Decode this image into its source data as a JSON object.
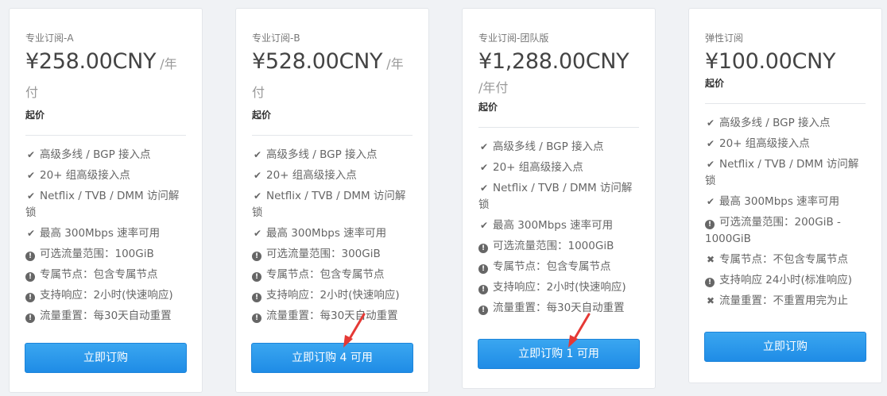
{
  "plans": [
    {
      "name": "专业订阅-A",
      "price": "¥258.00CNY",
      "unit_inline": "/年",
      "unit_wrap": "付",
      "qi": "起价",
      "features": [
        {
          "icon": "check-icon",
          "text": "高级多线 / BGP 接入点"
        },
        {
          "icon": "check-icon",
          "text": "20+ 组高级接入点"
        },
        {
          "icon": "check-icon",
          "text": "Netflix / TVB / DMM 访问解锁"
        },
        {
          "icon": "check-icon",
          "text": "最高 300Mbps 速率可用"
        },
        {
          "icon": "info-icon",
          "text": "可选流量范围：100GiB"
        },
        {
          "icon": "info-icon",
          "text": "专属节点：包含专属节点"
        },
        {
          "icon": "info-icon",
          "text": "支持响应：2小时(快速响应)"
        },
        {
          "icon": "info-icon",
          "text": "流量重置：每30天自动重置"
        }
      ],
      "button": "立即订购"
    },
    {
      "name": "专业订阅-B",
      "price": "¥528.00CNY",
      "unit_inline": "/年",
      "unit_wrap": "付",
      "qi": "起价",
      "features": [
        {
          "icon": "check-icon",
          "text": "高级多线 / BGP 接入点"
        },
        {
          "icon": "check-icon",
          "text": "20+ 组高级接入点"
        },
        {
          "icon": "check-icon",
          "text": "Netflix / TVB / DMM 访问解锁"
        },
        {
          "icon": "check-icon",
          "text": "最高 300Mbps 速率可用"
        },
        {
          "icon": "info-icon",
          "text": "可选流量范围：300GiB"
        },
        {
          "icon": "info-icon",
          "text": "专属节点：包含专属节点"
        },
        {
          "icon": "info-icon",
          "text": "支持响应：2小时(快速响应)"
        },
        {
          "icon": "info-icon",
          "text": "流量重置：每30天自动重置"
        }
      ],
      "button": "立即订购 4 可用"
    },
    {
      "name": "专业订阅-团队版",
      "price": "¥1,288.00CNY",
      "unit_inline": "",
      "unit_wrap": "/年付",
      "qi": "起价",
      "features": [
        {
          "icon": "check-icon",
          "text": "高级多线 / BGP 接入点"
        },
        {
          "icon": "check-icon",
          "text": "20+ 组高级接入点"
        },
        {
          "icon": "check-icon",
          "text": "Netflix / TVB / DMM 访问解锁"
        },
        {
          "icon": "check-icon",
          "text": "最高 300Mbps 速率可用"
        },
        {
          "icon": "info-icon",
          "text": "可选流量范围：1000GiB"
        },
        {
          "icon": "info-icon",
          "text": "专属节点：包含专属节点"
        },
        {
          "icon": "info-icon",
          "text": "支持响应：2小时(快速响应)"
        },
        {
          "icon": "info-icon",
          "text": "流量重置：每30天自动重置"
        }
      ],
      "button": "立即订购 1 可用"
    },
    {
      "name": "弹性订阅",
      "price": "¥100.00CNY",
      "unit_inline": "",
      "unit_wrap": "",
      "qi": "起价",
      "features": [
        {
          "icon": "check-icon",
          "text": "高级多线 / BGP 接入点"
        },
        {
          "icon": "check-icon",
          "text": "20+ 组高级接入点"
        },
        {
          "icon": "check-icon",
          "text": "Netflix / TVB / DMM 访问解锁"
        },
        {
          "icon": "check-icon",
          "text": "最高 300Mbps 速率可用"
        },
        {
          "icon": "info-icon",
          "text": "可选流量范围：200GiB - 1000GiB"
        },
        {
          "icon": "times-icon",
          "text": "专属节点：不包含专属节点"
        },
        {
          "icon": "info-icon",
          "text": "支持响应 24小时(标准响应)"
        },
        {
          "icon": "times-icon",
          "text": "流量重置：不重置用完为止"
        }
      ],
      "button": "立即订购"
    }
  ],
  "colors": {
    "button": "#2196f3",
    "arrow": "#e53935"
  }
}
